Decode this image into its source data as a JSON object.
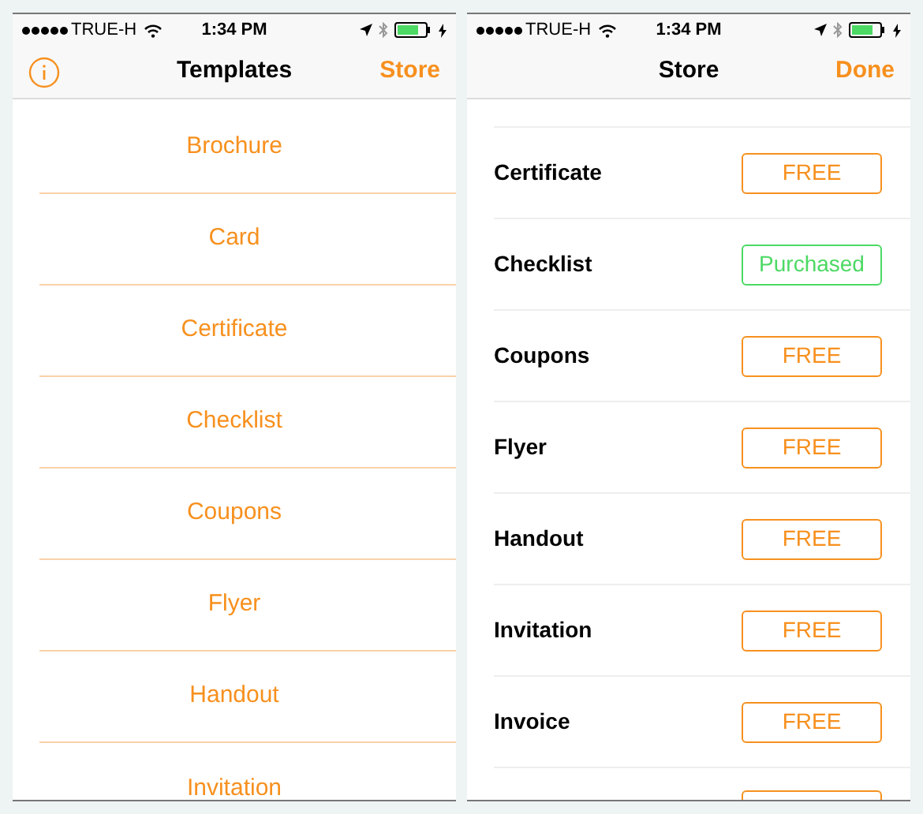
{
  "screens": [
    {
      "status_bar": {
        "carrier": "TRUE-H",
        "time": "1:34 PM"
      },
      "nav": {
        "title": "Templates",
        "right": "Store"
      },
      "list": [
        "Brochure",
        "Card",
        "Certificate",
        "Checklist",
        "Coupons",
        "Flyer",
        "Handout",
        "Invitation"
      ]
    },
    {
      "status_bar": {
        "carrier": "TRUE-H",
        "time": "1:34 PM"
      },
      "nav": {
        "title": "Store",
        "right": "Done"
      },
      "store": [
        {
          "name": "Certificate",
          "kind": "free",
          "button": "FREE"
        },
        {
          "name": "Checklist",
          "kind": "purchased",
          "button": "Purchased"
        },
        {
          "name": "Coupons",
          "kind": "free",
          "button": "FREE"
        },
        {
          "name": "Flyer",
          "kind": "free",
          "button": "FREE"
        },
        {
          "name": "Handout",
          "kind": "free",
          "button": "FREE"
        },
        {
          "name": "Invitation",
          "kind": "free",
          "button": "FREE"
        },
        {
          "name": "Invoice",
          "kind": "free",
          "button": "FREE"
        }
      ]
    }
  ]
}
